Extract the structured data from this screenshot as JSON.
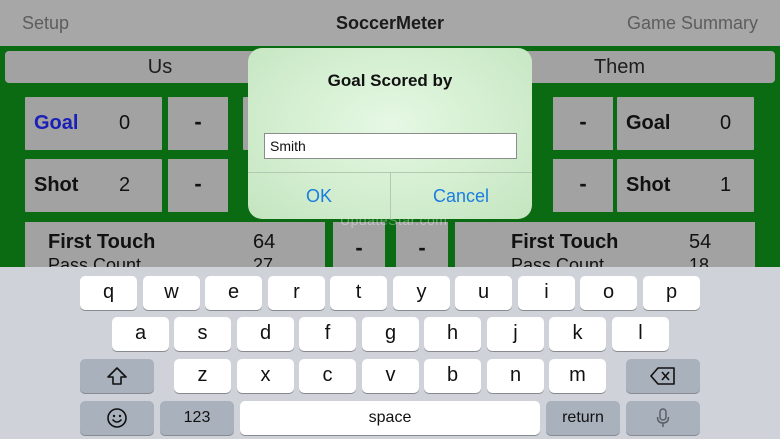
{
  "nav": {
    "left": "Setup",
    "title": "SoccerMeter",
    "right": "Game Summary"
  },
  "teams": {
    "us": "Us",
    "them": "Them"
  },
  "us": {
    "goal": {
      "label": "Goal",
      "value": "0",
      "accent": "#1a1fb8"
    },
    "shot": {
      "label": "Shot",
      "value": "2"
    },
    "first_touch": {
      "label": "First Touch",
      "value": "64"
    },
    "pass_count": {
      "label": "Pass Count",
      "value": "27"
    }
  },
  "them": {
    "goal": {
      "label": "Goal",
      "value": "0"
    },
    "shot": {
      "label": "Shot",
      "value": "1"
    },
    "first_touch": {
      "label": "First Touch",
      "value": "54"
    },
    "pass_count": {
      "label": "Pass Count",
      "value": "18"
    }
  },
  "minus_label": "-",
  "alert": {
    "title": "Goal Scored by",
    "input_value": "Smith",
    "ok": "OK",
    "cancel": "Cancel"
  },
  "watermark": "UpdateStar.com",
  "keyboard": {
    "row1": [
      "q",
      "w",
      "e",
      "r",
      "t",
      "y",
      "u",
      "i",
      "o",
      "p"
    ],
    "row2": [
      "a",
      "s",
      "d",
      "f",
      "g",
      "h",
      "j",
      "k",
      "l"
    ],
    "row3": [
      "z",
      "x",
      "c",
      "v",
      "b",
      "n",
      "m"
    ],
    "numbers": "123",
    "space": "space",
    "return": "return",
    "icons": {
      "shift": "shift-icon",
      "delete": "delete-icon",
      "emoji": "emoji-icon",
      "mic": "microphone-icon"
    }
  },
  "colors": {
    "field": "#0a6b12",
    "link": "#1a7de0"
  }
}
